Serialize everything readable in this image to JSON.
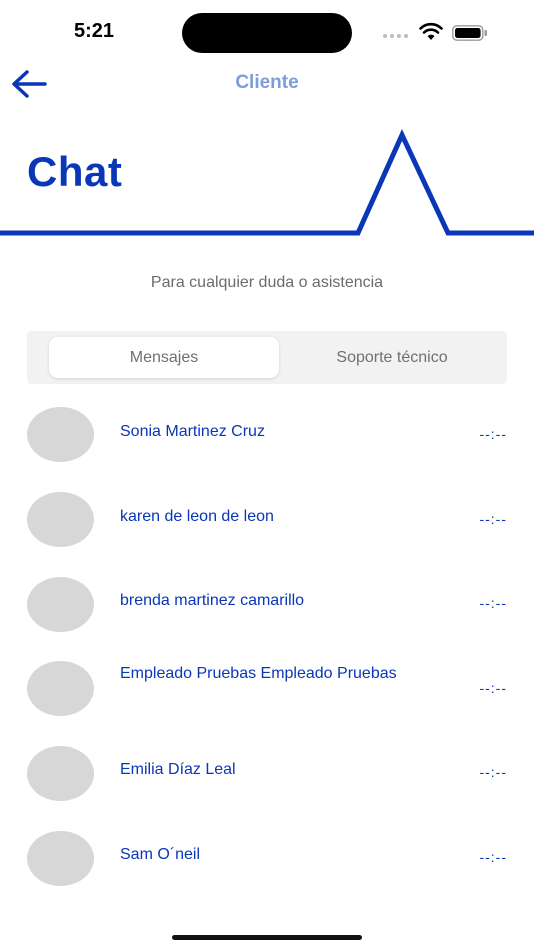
{
  "status_bar": {
    "time": "5:21"
  },
  "nav": {
    "title": "Cliente",
    "back_icon": "arrow-left-icon"
  },
  "header": {
    "title": "Chat"
  },
  "subtitle": "Para cualquier duda o asistencia",
  "tabs": [
    {
      "label": "Mensajes",
      "active": true
    },
    {
      "label": "Soporte técnico",
      "active": false
    }
  ],
  "chats": [
    {
      "name": "Sonia Martinez Cruz",
      "time": "--:--"
    },
    {
      "name": "karen de leon de leon",
      "time": "--:--"
    },
    {
      "name": "brenda martinez camarillo",
      "time": "--:--"
    },
    {
      "name": "Empleado Pruebas Empleado Pruebas",
      "time": "--:--"
    },
    {
      "name": "Emilia Díaz Leal",
      "time": "--:--"
    },
    {
      "name": "Sam O´neil",
      "time": "--:--"
    }
  ],
  "colors": {
    "accent": "#0a36b8",
    "nav_title": "#7d9cdc",
    "avatar": "#d7d7d7"
  }
}
